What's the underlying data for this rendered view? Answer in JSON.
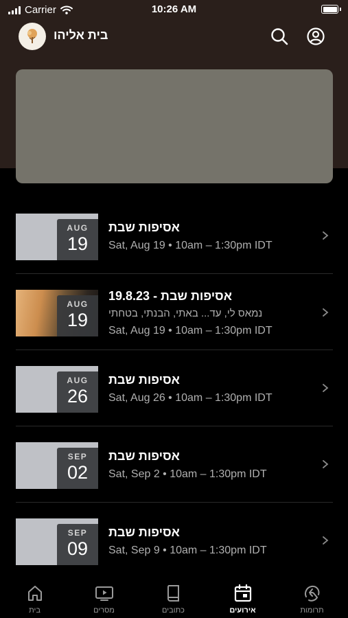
{
  "status_bar": {
    "carrier": "Carrier",
    "time": "10:26 AM"
  },
  "header": {
    "title": "בית אליהו"
  },
  "events": [
    {
      "month": "AUG",
      "day": "19",
      "title": "אסיפות שבת",
      "subtitle": "",
      "time": "Sat, Aug 19 • 10am – 1:30pm IDT",
      "thumbnail": "placeholder"
    },
    {
      "month": "AUG",
      "day": "19",
      "title": "אסיפות שבת - 19.8.23",
      "subtitle": "נמאס לי, עד... באתי, הבנתי, בטחתי",
      "time": "Sat, Aug 19 • 10am – 1:30pm IDT",
      "thumbnail": "photo"
    },
    {
      "month": "AUG",
      "day": "26",
      "title": "אסיפות שבת",
      "subtitle": "",
      "time": "Sat, Aug 26 • 10am – 1:30pm IDT",
      "thumbnail": "placeholder"
    },
    {
      "month": "SEP",
      "day": "02",
      "title": "אסיפות שבת",
      "subtitle": "",
      "time": "Sat, Sep 2 • 10am – 1:30pm IDT",
      "thumbnail": "placeholder"
    },
    {
      "month": "SEP",
      "day": "09",
      "title": "אסיפות שבת",
      "subtitle": "",
      "time": "Sat, Sep 9 • 10am – 1:30pm IDT",
      "thumbnail": "placeholder"
    }
  ],
  "tabs": [
    {
      "label": "בית",
      "icon": "home-icon"
    },
    {
      "label": "מסרים",
      "icon": "tv-icon"
    },
    {
      "label": "כתובים",
      "icon": "book-icon"
    },
    {
      "label": "אירועים",
      "icon": "calendar-icon",
      "active": true
    },
    {
      "label": "תרומות",
      "icon": "donation-icon"
    }
  ],
  "colors": {
    "header_bg": "#2a1f1b",
    "banner": "#75736a",
    "thumbnail": "#bfc1c6"
  }
}
